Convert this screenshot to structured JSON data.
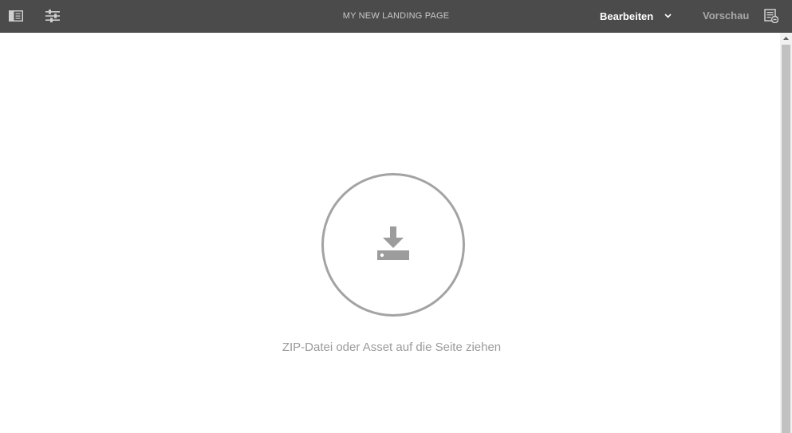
{
  "header": {
    "title": "MY NEW LANDING PAGE",
    "mode_selected": "Bearbeiten",
    "preview_label": "Vorschau",
    "icons": {
      "side_panel": "side-panel-icon",
      "page_properties": "sliders-icon",
      "mode_dropdown": "chevron-down-icon",
      "page_information": "page-info-icon"
    }
  },
  "drop_zone": {
    "icon": "download-tray-icon",
    "message": "ZIP-Datei oder Asset auf die Seite ziehen"
  },
  "colors": {
    "topbar": "#4b4b4b",
    "title_text": "#c8c8c8",
    "mode_text": "#ffffff",
    "preview_text": "#a8a8a8",
    "drop_zone_gray": "#a3a3a3"
  }
}
